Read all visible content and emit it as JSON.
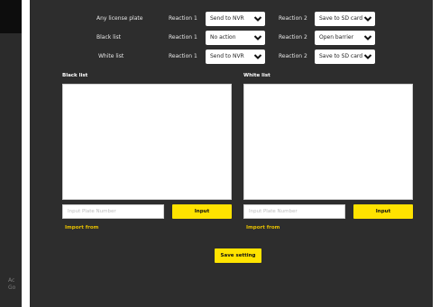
{
  "sidebar": {
    "footer_text": [
      "Ac",
      "Go"
    ]
  },
  "rules": [
    {
      "name": "Any license plate",
      "reaction1_label": "Reaction 1",
      "reaction1": "Send to NVR",
      "reaction2_label": "Reaction 2",
      "reaction2": "Save to SD card"
    },
    {
      "name": "Black list",
      "reaction1_label": "Reaction 1",
      "reaction1": "No action",
      "reaction2_label": "Reaction 2",
      "reaction2": "Open barrier"
    },
    {
      "name": "White list",
      "reaction1_label": "Reaction 1",
      "reaction1": "Send to NVR",
      "reaction2_label": "Reaction 2",
      "reaction2": "Save to SD card"
    }
  ],
  "black_list": {
    "title": "Black list",
    "placeholder": "Input Plate Number",
    "input_button": "Input",
    "import_link": "Import from"
  },
  "white_list": {
    "title": "White list",
    "placeholder": "Input Plate Number",
    "input_button": "Input",
    "import_link": "Import from"
  },
  "save_button": "Save setting",
  "colors": {
    "panel": "#2d2d2d",
    "accent": "#ffe300",
    "link": "#e8c100"
  }
}
